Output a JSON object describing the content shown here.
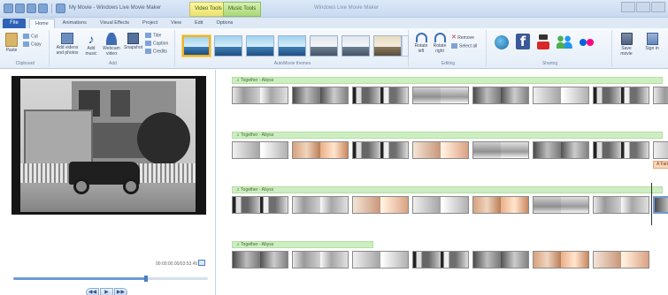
{
  "window": {
    "title": "My Movie - Windows Live Movie Maker",
    "context_tabs": [
      "Video Tools",
      "Music Tools"
    ],
    "title_suffix": "Windows Live Movie Maker"
  },
  "menu": {
    "file_label": "File",
    "tabs": [
      "Home",
      "Animations",
      "Visual Effects",
      "Project",
      "View",
      "Edit",
      "Options"
    ],
    "active_tab": "Home"
  },
  "ribbon": {
    "clipboard": {
      "label": "Clipboard",
      "paste": "Paste",
      "cut": "Cut",
      "copy": "Copy"
    },
    "add": {
      "label": "Add",
      "add_videos_photos": "Add videos and photos",
      "add_music": "Add music",
      "webcam_video": "Webcam video",
      "snapshot": "Snapshot",
      "title": "Title",
      "caption": "Caption",
      "credits": "Credits"
    },
    "automovie": {
      "label": "AutoMovie themes"
    },
    "editing": {
      "label": "Editing",
      "rotate_left": "Rotate left",
      "rotate_right": "Rotate right",
      "remove": "Remove",
      "select_all": "Select all"
    },
    "sharing": {
      "label": "Sharing"
    },
    "save_movie": "Save movie",
    "sign_in": "Sign in"
  },
  "preview": {
    "timecode": "00:00:00.00/03:53.45",
    "progress": 0.68
  },
  "storyboard": {
    "music_label": "Together - Abyss",
    "caption_text": "A Famous Road Trip...",
    "tracks": [
      {
        "clips": [
          "g1",
          "g2",
          "g4",
          "g5",
          "g2",
          "g3",
          "g4",
          "g1"
        ],
        "bar_width": 487
      },
      {
        "clips": [
          "g3",
          "s1",
          "g4",
          "s2",
          "g5",
          "g2",
          "g4",
          "g3"
        ],
        "bar_width": 487
      },
      {
        "clips": [
          "g4",
          "g1",
          "s2",
          "g3",
          "s1",
          "g5",
          "g1",
          "g2"
        ],
        "bar_width": 487
      },
      {
        "clips": [
          "g2",
          "g1",
          "g3",
          "g4",
          "g2",
          "s1",
          "s2"
        ],
        "bar_width": 160
      }
    ]
  },
  "colors": {
    "file_button": "#2e62b6",
    "music_bar": "#cdeec2",
    "caption_tag": "#f7d6bb",
    "selection": "#f0b429"
  }
}
